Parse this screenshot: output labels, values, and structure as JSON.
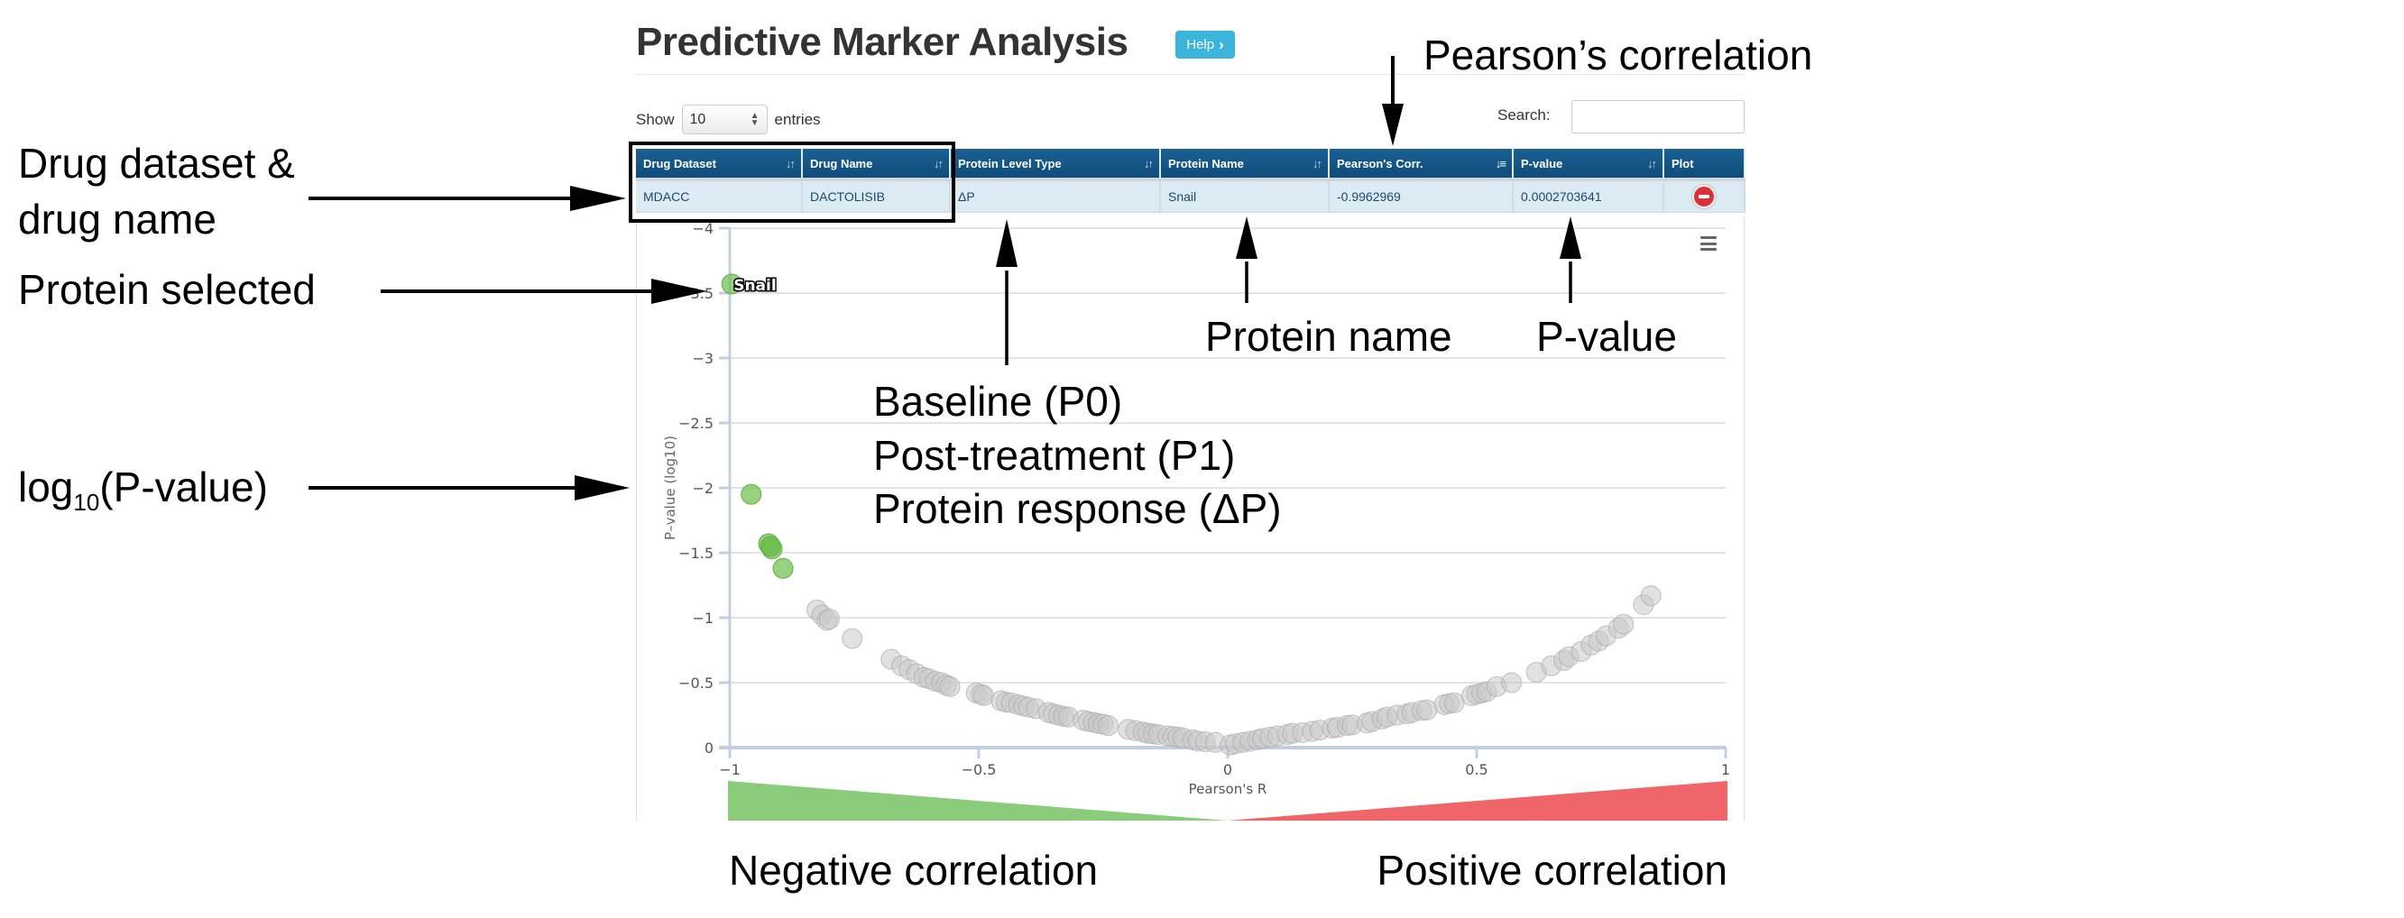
{
  "header": {
    "title": "Predictive Marker Analysis",
    "help_label": "Help",
    "help_icon": "chevron-right-icon"
  },
  "controls": {
    "show_label": "Show",
    "entries_value": "10",
    "entries_label": "entries",
    "search_label": "Search:",
    "search_value": ""
  },
  "table": {
    "columns": [
      {
        "label": "Drug Dataset",
        "sort_icon": "sort-icon"
      },
      {
        "label": "Drug Name",
        "sort_icon": "sort-icon"
      },
      {
        "label": "Protein Level Type",
        "sort_icon": "sort-icon"
      },
      {
        "label": "Protein Name",
        "sort_icon": "sort-icon"
      },
      {
        "label": "Pearson's Corr.",
        "sort_icon": "sort-ascending-icon"
      },
      {
        "label": "P-value",
        "sort_icon": "sort-icon"
      },
      {
        "label": "Plot",
        "sort_icon": ""
      }
    ],
    "rows": [
      {
        "drug_dataset": "MDACC",
        "drug_name": "DACTOLISIB",
        "protein_level_type": "ΔP",
        "protein_name": "Snail",
        "pearson_corr": "-0.9962969",
        "p_value": "0.0002703641",
        "plot_icon": "remove-circle-icon"
      }
    ]
  },
  "chart_menu_icon": "hamburger-menu-icon",
  "chart_data": {
    "type": "scatter",
    "title": "",
    "xlabel": "Pearson's R",
    "ylabel": "P–value (log10)",
    "xlim": [
      -1,
      1
    ],
    "ylim": [
      -4,
      0
    ],
    "y_reversed": true,
    "xticks": [
      "-1",
      "-0.5",
      "0",
      "0.5",
      "1"
    ],
    "yticks": [
      "-4",
      "-3.5",
      "-3",
      "-2.5",
      "-2",
      "-1.5",
      "-1",
      "-0.5",
      "0"
    ],
    "grid": true,
    "colors": {
      "significant": "#6cbf4a",
      "nonsignificant": "#cccccc",
      "negative_band": "#8bcb7c",
      "positive_band": "#ef6569"
    },
    "highlight": {
      "label": "Snail",
      "x": -0.996,
      "y": -3.57
    },
    "series": [
      {
        "name": "significant",
        "points": [
          [
            -0.996,
            -3.57
          ],
          [
            -0.957,
            -1.95
          ],
          [
            -0.922,
            -1.57
          ],
          [
            -0.915,
            -1.53
          ],
          [
            -0.918,
            -1.55
          ],
          [
            -0.893,
            -1.38
          ]
        ]
      },
      {
        "name": "nonsignificant",
        "points": [
          [
            -0.825,
            -1.06
          ],
          [
            -0.815,
            -1.02
          ],
          [
            -0.805,
            -0.98
          ],
          [
            -0.8,
            -0.99
          ],
          [
            -0.754,
            -0.84
          ],
          [
            -0.676,
            -0.68
          ],
          [
            -0.655,
            -0.63
          ],
          [
            -0.64,
            -0.6
          ],
          [
            -0.625,
            -0.57
          ],
          [
            -0.61,
            -0.54
          ],
          [
            -0.6,
            -0.53
          ],
          [
            -0.587,
            -0.51
          ],
          [
            -0.575,
            -0.5
          ],
          [
            -0.565,
            -0.48
          ],
          [
            -0.558,
            -0.47
          ],
          [
            -0.505,
            -0.42
          ],
          [
            -0.495,
            -0.41
          ],
          [
            -0.49,
            -0.4
          ],
          [
            -0.455,
            -0.36
          ],
          [
            -0.445,
            -0.35
          ],
          [
            -0.435,
            -0.345
          ],
          [
            -0.42,
            -0.33
          ],
          [
            -0.41,
            -0.32
          ],
          [
            -0.4,
            -0.31
          ],
          [
            -0.385,
            -0.3
          ],
          [
            -0.36,
            -0.27
          ],
          [
            -0.35,
            -0.26
          ],
          [
            -0.34,
            -0.25
          ],
          [
            -0.33,
            -0.24
          ],
          [
            -0.32,
            -0.235
          ],
          [
            -0.29,
            -0.21
          ],
          [
            -0.28,
            -0.2
          ],
          [
            -0.27,
            -0.195
          ],
          [
            -0.26,
            -0.185
          ],
          [
            -0.25,
            -0.18
          ],
          [
            -0.24,
            -0.17
          ],
          [
            -0.2,
            -0.14
          ],
          [
            -0.185,
            -0.13
          ],
          [
            -0.17,
            -0.12
          ],
          [
            -0.16,
            -0.11
          ],
          [
            -0.15,
            -0.105
          ],
          [
            -0.14,
            -0.1
          ],
          [
            -0.12,
            -0.09
          ],
          [
            -0.11,
            -0.085
          ],
          [
            -0.1,
            -0.08
          ],
          [
            -0.09,
            -0.075
          ],
          [
            -0.07,
            -0.06
          ],
          [
            -0.06,
            -0.05
          ],
          [
            -0.045,
            -0.045
          ],
          [
            -0.025,
            -0.04
          ],
          [
            0.005,
            -0.02
          ],
          [
            0.016,
            -0.03
          ],
          [
            0.03,
            -0.04
          ],
          [
            0.045,
            -0.05
          ],
          [
            0.06,
            -0.06
          ],
          [
            0.07,
            -0.07
          ],
          [
            0.085,
            -0.08
          ],
          [
            0.1,
            -0.09
          ],
          [
            0.12,
            -0.1
          ],
          [
            0.13,
            -0.11
          ],
          [
            0.15,
            -0.115
          ],
          [
            0.17,
            -0.125
          ],
          [
            0.185,
            -0.135
          ],
          [
            0.21,
            -0.15
          ],
          [
            0.22,
            -0.155
          ],
          [
            0.24,
            -0.17
          ],
          [
            0.25,
            -0.175
          ],
          [
            0.28,
            -0.19
          ],
          [
            0.29,
            -0.2
          ],
          [
            0.31,
            -0.22
          ],
          [
            0.32,
            -0.235
          ],
          [
            0.34,
            -0.25
          ],
          [
            0.36,
            -0.26
          ],
          [
            0.37,
            -0.27
          ],
          [
            0.39,
            -0.285
          ],
          [
            0.4,
            -0.29
          ],
          [
            0.435,
            -0.33
          ],
          [
            0.445,
            -0.34
          ],
          [
            0.455,
            -0.345
          ],
          [
            0.49,
            -0.4
          ],
          [
            0.5,
            -0.41
          ],
          [
            0.51,
            -0.42
          ],
          [
            0.52,
            -0.43
          ],
          [
            0.54,
            -0.47
          ],
          [
            0.57,
            -0.5
          ],
          [
            0.62,
            -0.58
          ],
          [
            0.65,
            -0.63
          ],
          [
            0.675,
            -0.67
          ],
          [
            0.685,
            -0.7
          ],
          [
            0.71,
            -0.74
          ],
          [
            0.73,
            -0.79
          ],
          [
            0.745,
            -0.82
          ],
          [
            0.76,
            -0.86
          ],
          [
            0.785,
            -0.92
          ],
          [
            0.795,
            -0.95
          ],
          [
            0.835,
            -1.1
          ],
          [
            0.85,
            -1.17
          ]
        ]
      }
    ],
    "bands": [
      {
        "name": "Negative correlation",
        "from": -1,
        "to": 0,
        "color": "#8bcb7c"
      },
      {
        "name": "Positive correlation",
        "from": 0,
        "to": 1,
        "color": "#ef6569"
      }
    ]
  },
  "annotations": {
    "drug_dataset": [
      "Drug dataset &",
      "drug name"
    ],
    "protein_selected": "Protein selected",
    "log_pvalue_main": "log",
    "log_pvalue_sub": "10",
    "log_pvalue_rest": "(P-value)",
    "pearson": "Pearson’s correlation",
    "protein_name": "Protein name",
    "p_value": "P-value",
    "level_types": [
      "Baseline (P0)",
      "Post-treatment (P1)",
      "Protein response (ΔP)"
    ],
    "negative": "Negative correlation",
    "positive": "Positive correlation"
  }
}
